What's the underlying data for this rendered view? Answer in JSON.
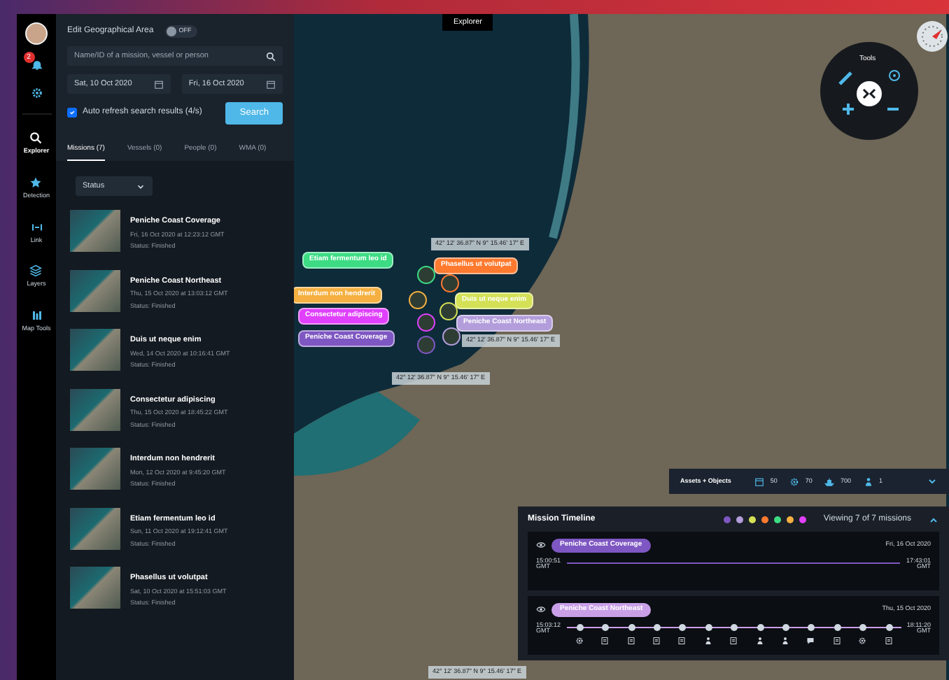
{
  "rail": {
    "notification_count": "2",
    "items": [
      {
        "label": "Explorer",
        "kind": "search",
        "selected": true
      },
      {
        "label": "Detection",
        "kind": "star",
        "selected": false
      },
      {
        "label": "Link",
        "kind": "link",
        "selected": false
      },
      {
        "label": "Layers",
        "kind": "layers",
        "selected": false
      },
      {
        "label": "Map Tools",
        "kind": "tools",
        "selected": false
      }
    ]
  },
  "panel": {
    "geo_toggle": {
      "label": "Edit Geographical Area",
      "state": "OFF",
      "on": false
    },
    "search": {
      "placeholder": "Name/ID of a mission, vessel or person"
    },
    "dates": [
      "Sat, 10 Oct 2020",
      "Fri, 16 Oct 2020"
    ],
    "auto_refresh": {
      "label": "Auto refresh search results (4/s)",
      "checked": true
    },
    "search_button": "Search",
    "tabs": [
      {
        "label": "Missions (7)",
        "selected": true
      },
      {
        "label": "Vessels (0)",
        "selected": false
      },
      {
        "label": "People (0)",
        "selected": false
      },
      {
        "label": "WMA (0)",
        "selected": false
      }
    ],
    "status_filter": "Status",
    "missions": [
      {
        "title": "Peniche Coast Coverage",
        "date": "Fri, 16 Oct 2020 at 12:23:12 GMT",
        "status": "Status: Finished"
      },
      {
        "title": "Peniche Coast Northeast",
        "date": "Thu, 15 Oct 2020 at 13:03:12 GMT",
        "status": "Status: Finished"
      },
      {
        "title": "Duis ut neque enim",
        "date": "Wed, 14 Oct 2020 at 10:16:41 GMT",
        "status": "Status: Finished"
      },
      {
        "title": "Consectetur adipiscing",
        "date": "Thu, 15 Oct 2020 at 18:45:22 GMT",
        "status": "Status: Finished"
      },
      {
        "title": "Interdum non hendrerit",
        "date": "Mon, 12 Oct 2020 at 9:45:20 GMT",
        "status": "Status: Finished"
      },
      {
        "title": "Etiam fermentum leo id",
        "date": "Sun, 11 Oct 2020 at 19:12:41 GMT",
        "status": "Status: Finished"
      },
      {
        "title": "Phasellus ut volutpat",
        "date": "Sat, 10 Oct 2020 at 15:51:03 GMT",
        "status": "Status: Finished"
      }
    ]
  },
  "map": {
    "tab": "Explorer",
    "tools_label": "Tools",
    "pins": [
      {
        "label": "Etiam fermentum leo id",
        "color": "#3ddc84"
      },
      {
        "label": "Phasellus ut volutpat",
        "color": "#ff7a2f"
      },
      {
        "label": "Interdum non hendrerit",
        "color": "#f5b041"
      },
      {
        "label": "Duis ut neque enim",
        "color": "#d4e157"
      },
      {
        "label": "Consectetur adipiscing",
        "color": "#e040fb"
      },
      {
        "label": "Peniche Coast Northeast",
        "color": "#b39ddb"
      },
      {
        "label": "Peniche Coast Coverage",
        "color": "#7e57c2"
      }
    ],
    "coordinates": [
      "42° 12' 36.87\" N 9° 15.46' 17\" E",
      "42° 12' 36.87\" N 9° 15.46' 17\" E",
      "42° 12' 36.87\" N 9° 15.46' 17\" E",
      "42° 12' 36.87\" N 9° 15.46' 17\" E"
    ]
  },
  "assets": {
    "title": "Assets + Objects",
    "counts": [
      {
        "kind": "calendar",
        "value": "50"
      },
      {
        "kind": "gear",
        "value": "70"
      },
      {
        "kind": "ship",
        "value": "700"
      },
      {
        "kind": "person",
        "value": "1"
      }
    ]
  },
  "timeline": {
    "title": "Mission Timeline",
    "legend": [
      {
        "color": "#7e57c2"
      },
      {
        "color": "#b39ddb"
      },
      {
        "color": "#d4e157"
      },
      {
        "color": "#ff7a2f"
      },
      {
        "color": "#3ddc84"
      },
      {
        "color": "#f5b041"
      },
      {
        "color": "#e040fb"
      }
    ],
    "viewing": "Viewing 7 of 7 missions",
    "rows": [
      {
        "mission": "Peniche Coast Coverage",
        "color": "#7e57c2",
        "date": "Fri, 16 Oct 2020",
        "start": "15:00:51",
        "start_zone": "GMT",
        "end": "17:43:01",
        "end_zone": "GMT",
        "events": []
      },
      {
        "mission": "Peniche Coast Northeast",
        "color": "#c9a0e8",
        "date": "Thu, 15 Oct 2020",
        "start": "15:03:12",
        "start_zone": "GMT",
        "end": "18:11:20",
        "end_zone": "GMT",
        "events": [
          {
            "kind": "gear"
          },
          {
            "kind": "doc"
          },
          {
            "kind": "doc"
          },
          {
            "kind": "doc"
          },
          {
            "kind": "doc"
          },
          {
            "kind": "person"
          },
          {
            "kind": "doc"
          },
          {
            "kind": "person"
          },
          {
            "kind": "person"
          },
          {
            "kind": "chat"
          },
          {
            "kind": "doc"
          },
          {
            "kind": "gear"
          },
          {
            "kind": "doc"
          }
        ]
      }
    ]
  }
}
